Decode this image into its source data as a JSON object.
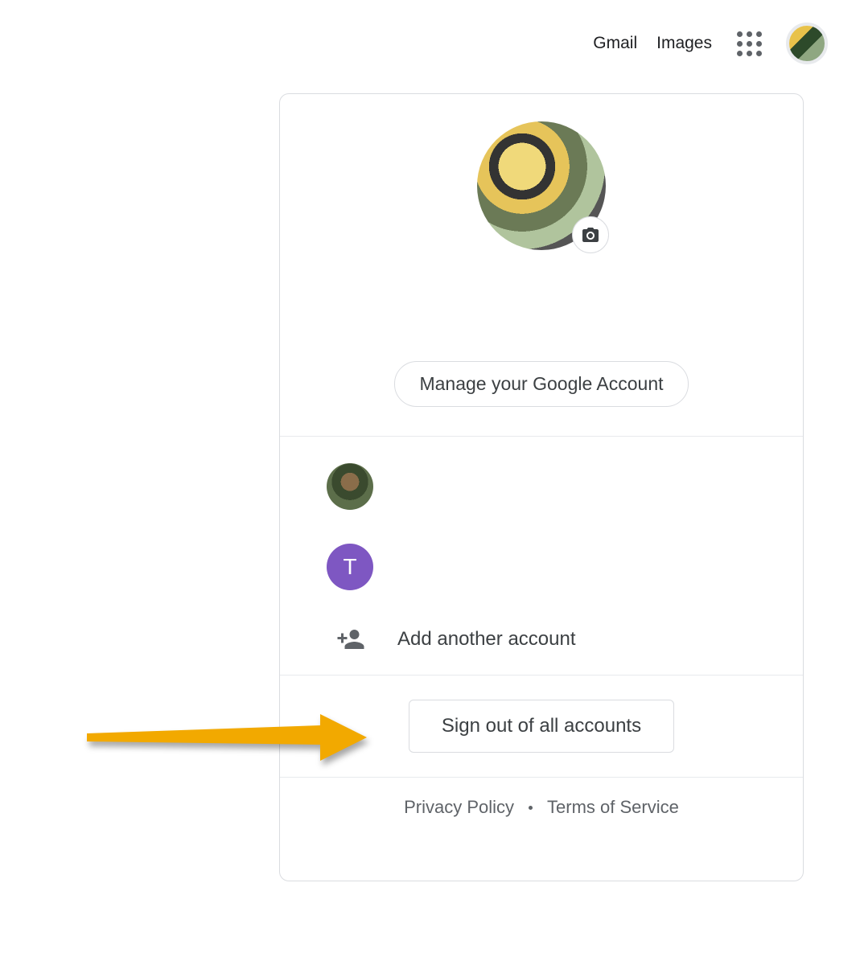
{
  "topbar": {
    "gmail": "Gmail",
    "images": "Images"
  },
  "popup": {
    "manage_label": "Manage your Google Account",
    "accounts": [
      {
        "type": "photo"
      },
      {
        "type": "letter",
        "initial": "T",
        "color": "#7e57c2"
      }
    ],
    "add_account_label": "Add another account",
    "signout_label": "Sign out of all accounts",
    "footer": {
      "privacy": "Privacy Policy",
      "terms": "Terms of Service"
    }
  },
  "annotation": {
    "arrow_color": "#f2a900"
  }
}
